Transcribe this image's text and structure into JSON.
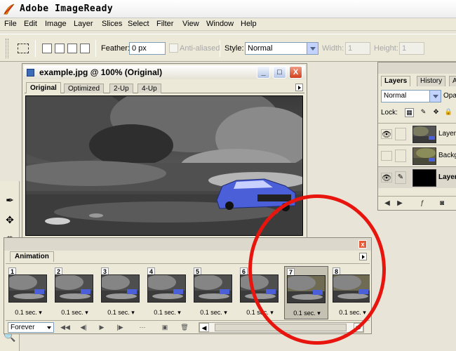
{
  "app": {
    "title": "Adobe ImageReady",
    "icon": "imageready-feather-icon"
  },
  "menubar": [
    "File",
    "Edit",
    "Image",
    "Layer",
    "Slices",
    "Select",
    "Filter",
    "View",
    "Window",
    "Help"
  ],
  "options": {
    "feather_label": "Feather:",
    "feather_value": "0 px",
    "anti_aliased_label": "Anti-aliased",
    "style_label": "Style:",
    "style_value": "Normal",
    "width_label": "Width:",
    "width_value": "1",
    "height_label": "Height:",
    "height_value": "1"
  },
  "document": {
    "title": "example.jpg @ 100% (Original)",
    "tabs": [
      "Original",
      "Optimized",
      "2-Up",
      "4-Up"
    ],
    "active_tab": "Original",
    "window_buttons": {
      "minimize": "_",
      "maximize": "□",
      "close": "X"
    }
  },
  "layers_panel": {
    "tabs": [
      "Layers",
      "History",
      "A"
    ],
    "blend_mode": "Normal",
    "opacity_label": "Opa",
    "lock_label": "Lock:",
    "layers": [
      {
        "name": "Layer",
        "visible": true,
        "selected": false,
        "thumb": "photo"
      },
      {
        "name": "Backg",
        "visible": false,
        "selected": false,
        "thumb": "photo"
      },
      {
        "name": "Layer",
        "visible": true,
        "selected": true,
        "thumb": "black"
      }
    ]
  },
  "animation": {
    "tab": "Animation",
    "close": "x",
    "loop": "Forever",
    "frames": [
      {
        "number": "1",
        "delay": "0.1 sec.",
        "selected": false
      },
      {
        "number": "2",
        "delay": "0.1 sec.",
        "selected": false
      },
      {
        "number": "3",
        "delay": "0.1 sec.",
        "selected": false
      },
      {
        "number": "4",
        "delay": "0.1 sec.",
        "selected": false
      },
      {
        "number": "5",
        "delay": "0.1 sec.",
        "selected": false
      },
      {
        "number": "6",
        "delay": "0.1 sec.",
        "selected": false
      },
      {
        "number": "7",
        "delay": "0.1 sec.",
        "selected": true
      },
      {
        "number": "8",
        "delay": "0.1 sec.",
        "selected": false
      }
    ]
  },
  "colors": {
    "annotation": "#e8140e",
    "ui_face": "#ece9d8",
    "car_blue": "#4a5fd8"
  }
}
